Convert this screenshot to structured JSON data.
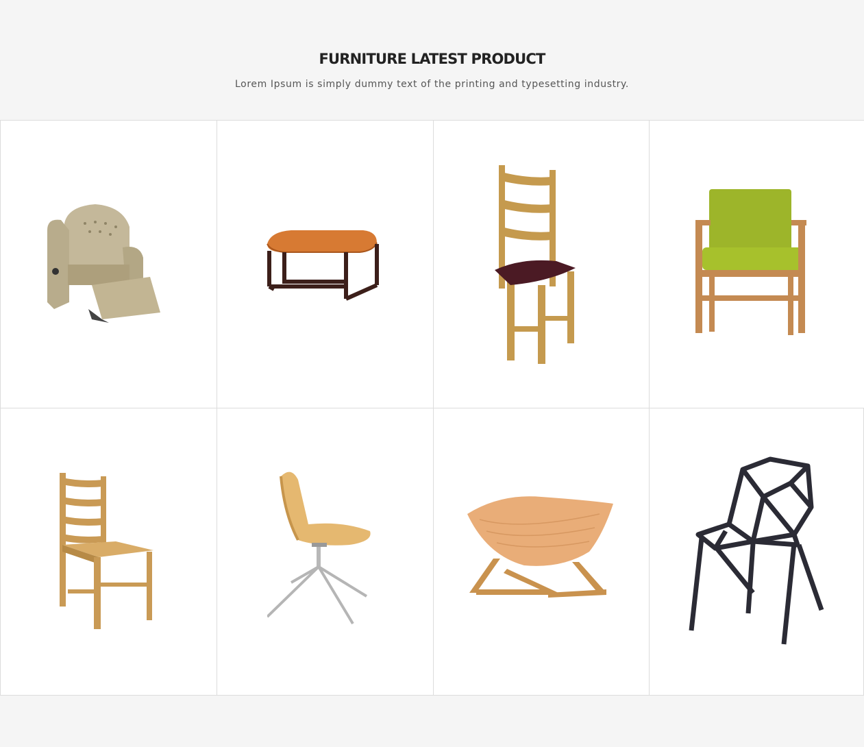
{
  "section": {
    "title": "FURNITURE LATEST PRODUCT",
    "subtitle": "Lorem Ipsum is simply dummy text of the printing and typesetting industry."
  },
  "products": [
    {
      "icon": "recliner-armchair-icon"
    },
    {
      "icon": "leather-ottoman-icon"
    },
    {
      "icon": "ladderback-chair-icon"
    },
    {
      "icon": "green-armchair-icon"
    },
    {
      "icon": "wooden-dining-chair-icon"
    },
    {
      "icon": "swivel-shell-chair-icon"
    },
    {
      "icon": "bentwood-bowl-chair-icon"
    },
    {
      "icon": "geometric-metal-chair-icon"
    }
  ],
  "colors": {
    "page_bg": "#f5f5f5",
    "tile_bg": "#ffffff",
    "tile_border": "#dcdcdc",
    "title": "#222222",
    "subtitle": "#555555"
  }
}
